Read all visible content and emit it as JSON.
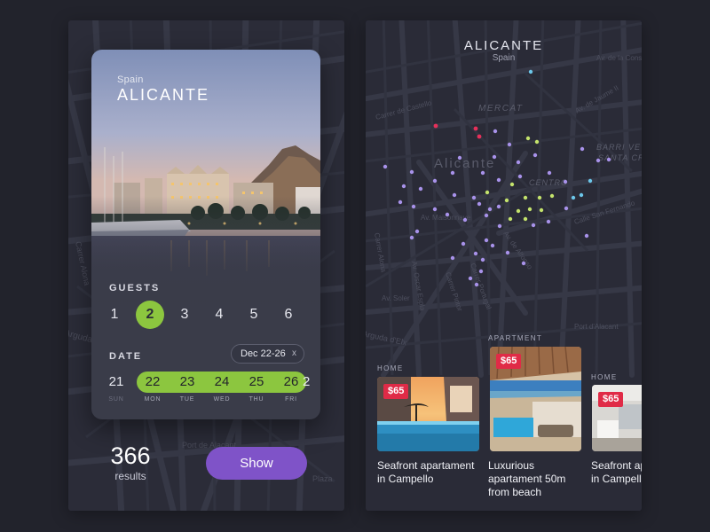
{
  "colors": {
    "background": "#22232c",
    "panel": "#2b2c38",
    "accent_green": "#8cc63f",
    "accent_purple": "#7f53c8",
    "price_badge": "#e02b47",
    "map_dot_purple": "#a892ea",
    "map_dot_green": "#c4e36c",
    "map_dot_blue": "#6cc7ea",
    "map_dot_red": "#e6305a"
  },
  "search_card": {
    "country": "Spain",
    "city": "ALICANTE",
    "hero_image": "alicante-harbour-photo",
    "guests": {
      "label": "GUESTS",
      "options": [
        "1",
        "2",
        "3",
        "4",
        "5",
        "6"
      ],
      "selected": "2"
    },
    "date": {
      "label": "DATE",
      "chip_text": "Dec 22-26",
      "chip_close": "x",
      "days": [
        {
          "num": "21",
          "dow": "SUN",
          "in_range": false
        },
        {
          "num": "22",
          "dow": "MON",
          "in_range": true
        },
        {
          "num": "23",
          "dow": "TUE",
          "in_range": true
        },
        {
          "num": "24",
          "dow": "WED",
          "in_range": true
        },
        {
          "num": "25",
          "dow": "THU",
          "in_range": true
        },
        {
          "num": "26",
          "dow": "FRI",
          "in_range": true
        },
        {
          "num": "2",
          "dow": "",
          "in_range": false
        }
      ]
    }
  },
  "footer": {
    "results_count": "366",
    "results_label": "results",
    "show_button": "Show"
  },
  "map_view": {
    "city": "ALICANTE",
    "country": "Spain",
    "map_labels": {
      "mercat": "MERCAT",
      "alicante": "Alicante",
      "centro": "CENTRO",
      "barri_vell": "BARRI VE",
      "santa_creu": "SANTA CRE",
      "av_maisonnave": "Av. Maisonnave",
      "av_alfonso": "Av. de Alfonso",
      "av_oscar": "Av. Oscar Espla",
      "carrer_portugal": "Carrer Portugal",
      "calle_san_fernando": "Calle San Fernando",
      "av_jaume": "Av. de Jaume II",
      "av_constitucion": "Av. de la Constitucion",
      "carrer_alona": "Carrer Alona",
      "av_soler": "Av. Soler",
      "av_dolores": "Av. de Dolores",
      "carrer_pintor": "Carrer Pintor",
      "carrer_de_castellon": "Carrer de Castello",
      "port": "Port d'Alacant",
      "arguda": "Arguda d'Elx"
    },
    "listings": [
      {
        "category": "HOME",
        "price": "$65",
        "title": "Seafront apartament in Campello",
        "image": "pool-sunset-photo"
      },
      {
        "category": "APARTMENT",
        "price": "$65",
        "title": "Luxurious apartament 50m from beach",
        "image": "terrace-sea-view-photo"
      },
      {
        "category": "HOME",
        "price": "$65",
        "title": "Seafront apartament in Campello",
        "image": "white-interior-photo"
      }
    ]
  },
  "left_map_labels": {
    "carrer_alona": "Carrer Alona",
    "arguda": "Arguda d'Elx",
    "port": "Port de Alacant",
    "plaza": "Plaza"
  }
}
